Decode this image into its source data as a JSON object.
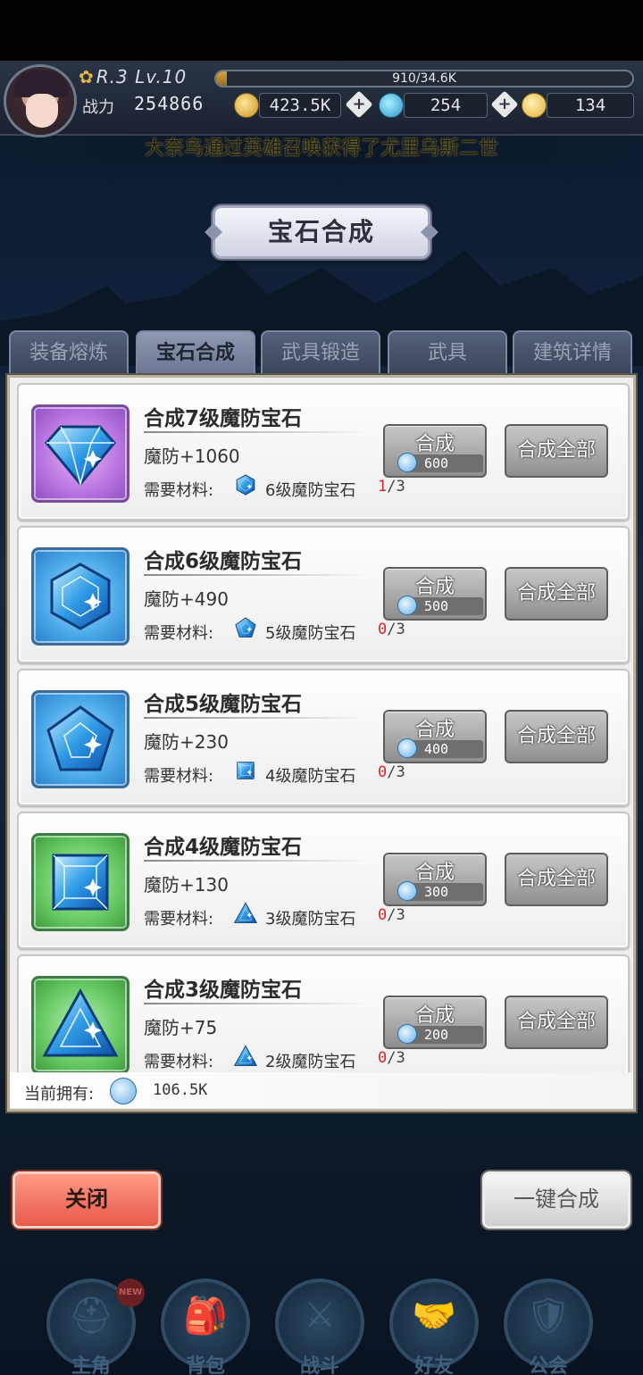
{
  "header": {
    "rank": "R.3 Lv.10",
    "xp_text": "910/34.6K",
    "xp_fraction": 0.026,
    "power_label": "战力",
    "power_value": "254866",
    "gold": "423.5K",
    "gems": "254",
    "tokens": "134",
    "marquee": "大奈鸟通过英雄召唤获得了尤里乌斯二世"
  },
  "title": "宝石合成",
  "tabs": [
    "装备熔炼",
    "宝石合成",
    "武具锻造",
    "武具",
    "建筑详情"
  ],
  "active_tab": 1,
  "labels": {
    "required": "需要材料:",
    "synth": "合成",
    "synth_all": "合成全部",
    "owned": "当前拥有:"
  },
  "recipes": [
    {
      "name": "合成7级魔防宝石",
      "stat": "魔防+1060",
      "material": "6级魔防宝石",
      "have": "1",
      "need": "/3",
      "cost": "600",
      "frame": "purple",
      "gem_shape": "octagon-gem-icon"
    },
    {
      "name": "合成6级魔防宝石",
      "stat": "魔防+490",
      "material": "5级魔防宝石",
      "have": "0",
      "need": "/3",
      "cost": "500",
      "frame": "blue",
      "gem_shape": "hexagon-gem-icon"
    },
    {
      "name": "合成5级魔防宝石",
      "stat": "魔防+230",
      "material": "4级魔防宝石",
      "have": "0",
      "need": "/3",
      "cost": "400",
      "frame": "blue",
      "gem_shape": "pentagon-gem-icon"
    },
    {
      "name": "合成4级魔防宝石",
      "stat": "魔防+130",
      "material": "3级魔防宝石",
      "have": "0",
      "need": "/3",
      "cost": "300",
      "frame": "green",
      "gem_shape": "square-gem-icon"
    },
    {
      "name": "合成3级魔防宝石",
      "stat": "魔防+75",
      "material": "2级魔防宝石",
      "have": "0",
      "need": "/3",
      "cost": "200",
      "frame": "green",
      "gem_shape": "triangle-gem-icon"
    }
  ],
  "owned_value": "106.5K",
  "buttons": {
    "close": "关闭",
    "one_key": "一键合成"
  },
  "nav": [
    {
      "label": "主角",
      "icon": "helmet-icon",
      "glyph": "⛑"
    },
    {
      "label": "背包",
      "icon": "backpack-icon",
      "glyph": "🎒"
    },
    {
      "label": "战斗",
      "icon": "crossed-swords-icon",
      "glyph": "⚔"
    },
    {
      "label": "好友",
      "icon": "handshake-icon",
      "glyph": "🤝"
    },
    {
      "label": "公会",
      "icon": "guild-emblem-icon",
      "glyph": "🛡"
    }
  ],
  "nav_badge": "NEW",
  "colors": {
    "accent_red": "#e8584a",
    "count_red": "#d3262a",
    "gem_blue": "#2f86d6"
  }
}
